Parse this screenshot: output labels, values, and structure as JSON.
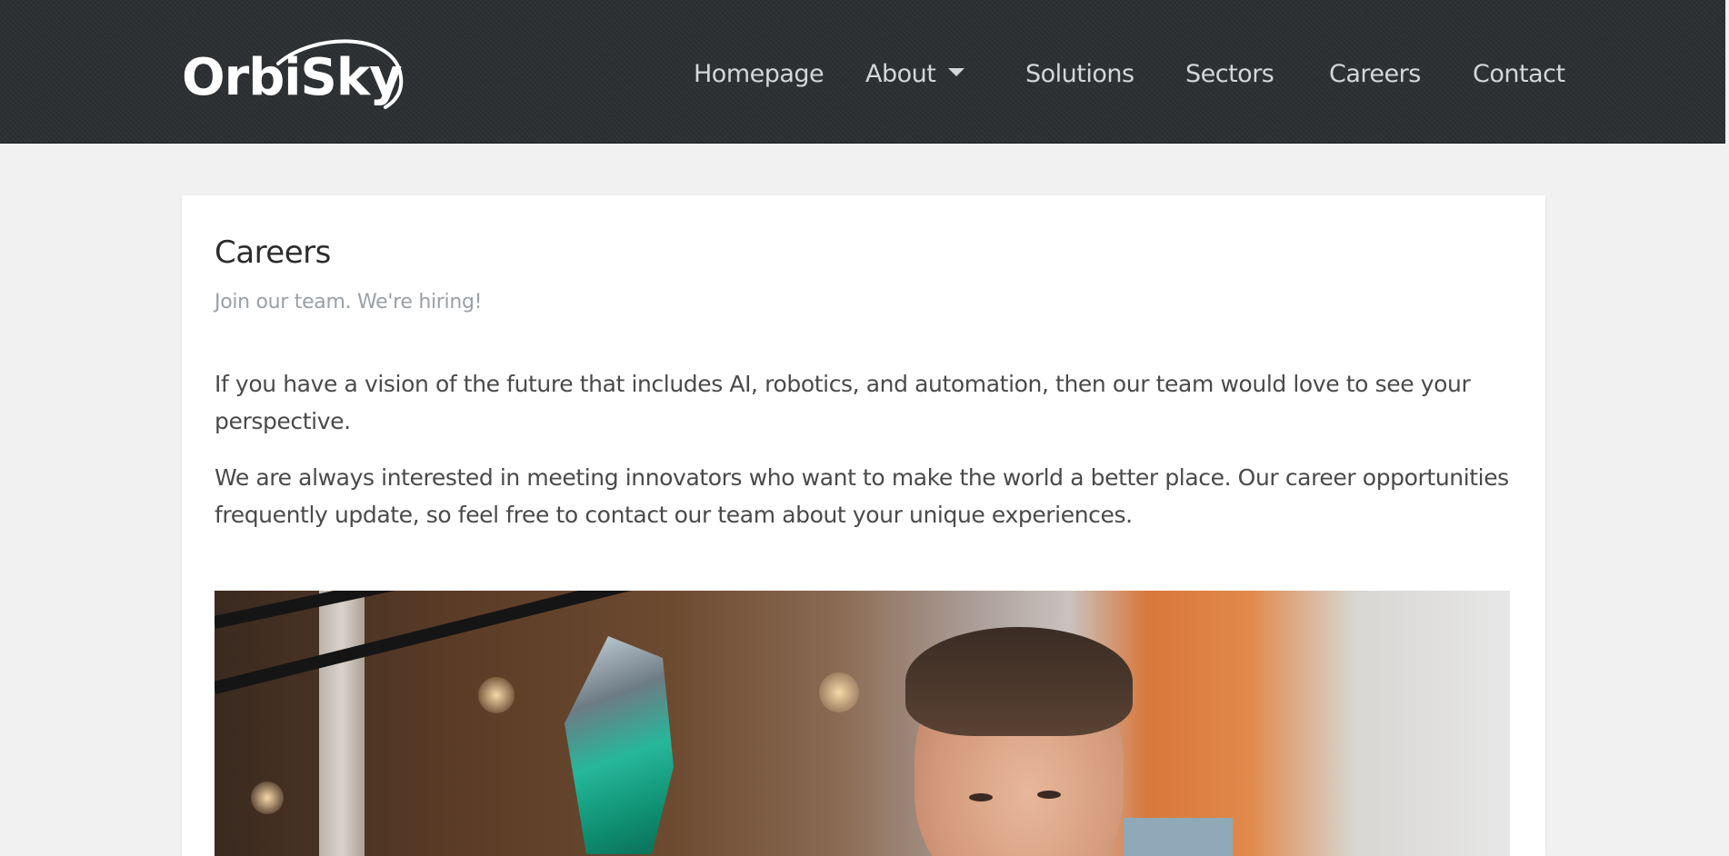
{
  "brand": {
    "logo_text": "OrbiSky"
  },
  "nav": {
    "items": [
      {
        "label": "Homepage",
        "has_dropdown": false
      },
      {
        "label": "About",
        "has_dropdown": true
      },
      {
        "label": "Solutions",
        "has_dropdown": false
      },
      {
        "label": "Sectors",
        "has_dropdown": false
      },
      {
        "label": "Careers",
        "has_dropdown": false
      },
      {
        "label": "Contact",
        "has_dropdown": false
      }
    ]
  },
  "page": {
    "title": "Careers",
    "subtitle": "Join our team. We're hiring!",
    "paragraphs": [
      "If you have a vision of the future that includes AI, robotics, and automation, then our team would love to see your perspective.",
      "We are always interested in meeting innovators who want to make the world a better place. Our career opportunities frequently update, so feel free to contact our team about your unique experiences."
    ]
  },
  "colors": {
    "header_bg": "#2d3033",
    "nav_text": "#d4d6d8",
    "page_bg": "#f1f1f1",
    "card_bg": "#ffffff",
    "title_text": "#2c2c2c",
    "subtitle_text": "#9aa0a6",
    "body_text": "#4a4a4a"
  }
}
